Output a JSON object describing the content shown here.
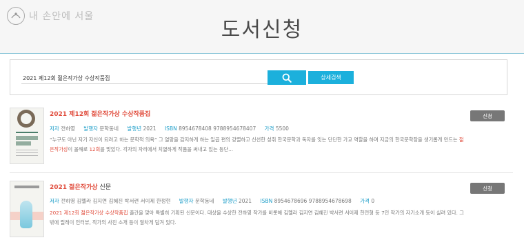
{
  "header": {
    "logo_text": "내 손안에 서울",
    "title": "도서신청"
  },
  "search": {
    "query": "2021 제12회 젊은작가상 수상작품집",
    "advanced_label": "상세검색"
  },
  "labels": {
    "author": "저자",
    "publisher": "발행자",
    "year": "발행년",
    "isbn": "ISBN",
    "price": "가격",
    "apply": "신청"
  },
  "results": [
    {
      "title": "2021 제12회 젊은작가상 수상작품집",
      "author": "전하영",
      "publisher": "문학동네",
      "year": "2021",
      "isbn": "8954678408 9788954678407",
      "price": "5500",
      "desc_part1": "“누구도 아닌 자기 자신이 되려고 하는 문학적 의욕” 그 열망을 감지하게 하는 일곱 편의 강렬하고 신선한 성취 한국문학과 독자를 잇는 단단한 가교 역할을 하며 지금의 한국문학장을 생기롭게 만드는 ",
      "desc_hl1": "젊은작가상",
      "desc_part2": "이 올해로 ",
      "desc_hl2": "12회",
      "desc_part3": "를 맞았다. 각자의 자리에서 치열하게 작품을 써내고 있는 등단..."
    },
    {
      "title_hl": "2021 젊은작가상",
      "title_plain": " 신문",
      "author": "전하영 김멜라 김지연 김혜진 박서련 서이제 한정현",
      "publisher": "문학동네",
      "year": "2021",
      "isbn": "8954678696 9788954678698",
      "price": "0",
      "desc_hl": "2021 제12회 젊은작가상 수상작품집",
      "desc_rest": " 출간을 맞아 특별히 기획된 신문이다. 대상을 수상한 전하영 작가를 비롯해 김멜라 김지연 김혜진 박서련 서이제 한전형 등 7인 작가의 자기소개 등이 실려 있다. 그 밖에 릴레이 인터뷰, 작가의 사진 소개 등이 알차게 담겨 있다."
    }
  ],
  "icons": {
    "logo": "seoul-logo-icon",
    "search": "search-icon"
  },
  "colors": {
    "accent": "#1cb0dc",
    "highlight": "#e04c3c",
    "button_gray": "#777777"
  }
}
